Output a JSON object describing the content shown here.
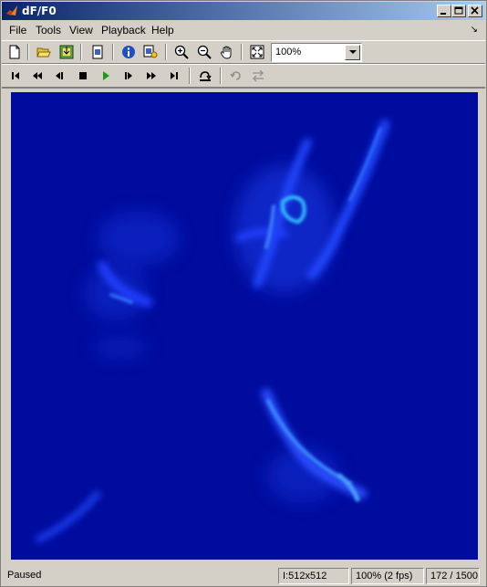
{
  "window": {
    "title": "dF/F0"
  },
  "menu": {
    "file": "File",
    "tools": "Tools",
    "view": "View",
    "playback": "Playback",
    "help": "Help"
  },
  "toolbar": {
    "zoom_value": "100%"
  },
  "status": {
    "state": "Paused",
    "image_size": "I:512x512",
    "zoom_fps": "100% (2 fps)",
    "frame": "172 / 1500"
  },
  "colors": {
    "image_background": "#000c9e",
    "titlebar": "#0a246a",
    "play_green": "#1a9e1a"
  }
}
